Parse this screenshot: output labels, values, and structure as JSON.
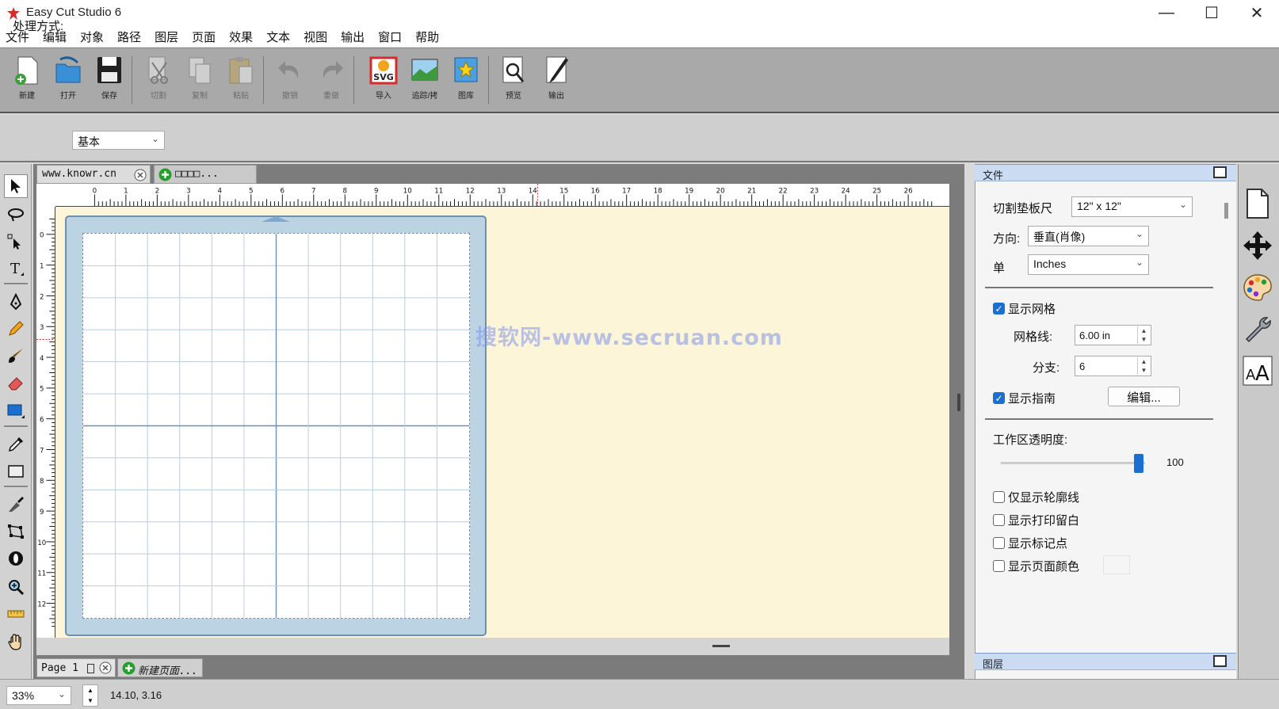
{
  "window": {
    "title": "Easy Cut Studio 6",
    "minimize": "—",
    "maximize": "☐",
    "close": "✕"
  },
  "menu": [
    "文件",
    "编辑",
    "对象",
    "路径",
    "图层",
    "页面",
    "效果",
    "文本",
    "视图",
    "输出",
    "窗口",
    "帮助"
  ],
  "toolbar": {
    "new": "新建",
    "open": "打开",
    "save": "保存",
    "cut": "切割",
    "copy": "复制",
    "paste": "粘贴",
    "undo": "撤销",
    "redo": "重做",
    "import": "导入",
    "trace": "追踪/拷",
    "library": "图库",
    "preview": "预览",
    "output": "输出",
    "svg_badge": "SVG"
  },
  "options": {
    "mode_label": "处理方式:",
    "mode_value": "基本"
  },
  "tabs": [
    {
      "label": "www.knowr.cn"
    },
    {
      "label": "□□□□..."
    }
  ],
  "ruler": {
    "h_labels": [
      "0",
      "1",
      "2",
      "3",
      "4",
      "5",
      "6",
      "7",
      "8",
      "9",
      "10",
      "11",
      "12",
      "13",
      "14",
      "15",
      "16",
      "17",
      "18",
      "19",
      "20",
      "21",
      "22",
      "23",
      "24",
      "25",
      "26",
      "2"
    ],
    "v_labels": [
      "1",
      "0",
      "1",
      "2",
      "3",
      "4",
      "5",
      "6",
      "7",
      "8",
      "9",
      "10",
      "11",
      "12"
    ]
  },
  "watermark": "搜软网-www.secruan.com",
  "pages": {
    "page_label": "Page 1",
    "new_page": "新建页面..."
  },
  "status": {
    "zoom": "33%",
    "coords": "14.10, 3.16"
  },
  "panel_file": {
    "title": "文件",
    "mat_label": "切割垫板尺",
    "mat_value": "12\" x 12\"",
    "orient_label": "方向:",
    "orient_value": "垂直(肖像)",
    "unit_label": "单",
    "unit_value": "Inches",
    "show_grid": "显示网格",
    "gridline_label": "网格线:",
    "gridline_value": "6.00 in",
    "subdiv_label": "分支:",
    "subdiv_value": "6",
    "show_guides": "显示指南",
    "edit_button": "编辑...",
    "opacity_label": "工作区透明度:",
    "opacity_value": "100",
    "outline_only": "仅显示轮廓线",
    "show_print_margin": "显示打印留白",
    "show_marks": "显示标记点",
    "show_page_color": "显示页面颜色"
  },
  "panel_layers": {
    "title": "图层"
  },
  "colors": {
    "accent": "#1a6fd1",
    "canvas": "#fdf5d8",
    "mat": "#bcd3e4",
    "panel_header": "#cbdcf2"
  }
}
